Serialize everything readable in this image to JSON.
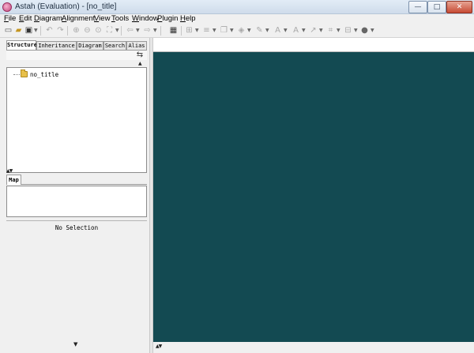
{
  "window": {
    "title": "Astah (Evaluation) - [no_title]",
    "controls": {
      "minimize": "—",
      "maximize": "□",
      "close": "✕"
    }
  },
  "menu": [
    "File",
    "Edit",
    "Diagram",
    "Alignment",
    "View",
    "Tools",
    "Window",
    "Plugin",
    "Help"
  ],
  "toolbar": {
    "icons": [
      "new-file-icon",
      "open-folder-icon",
      "save-icon",
      "undo-icon",
      "redo-icon",
      "zoom-in-icon",
      "zoom-out-icon",
      "zoom-fit-icon",
      "fit-window-icon",
      "back-icon",
      "forward-icon",
      "grid-icon",
      "align-icon",
      "distribute-icon",
      "layer-icon",
      "fill-color-icon",
      "line-color-icon",
      "font-color-icon",
      "font-size-icon",
      "line-style-icon",
      "arrange-icon",
      "layout-icon",
      "shape-circle-icon"
    ]
  },
  "left_panel": {
    "tabs": [
      "Structure",
      "Inheritance",
      "Diagram",
      "Search",
      "Alias"
    ],
    "active_tab": "Structure",
    "tree": {
      "root_label": "no_title"
    },
    "map_tab": "Map",
    "properties": {
      "empty_text": "No Selection"
    }
  },
  "colors": {
    "canvas_bg": "#134a52",
    "panel_bg": "#f0f0f0",
    "folder": "#e8c04a"
  }
}
